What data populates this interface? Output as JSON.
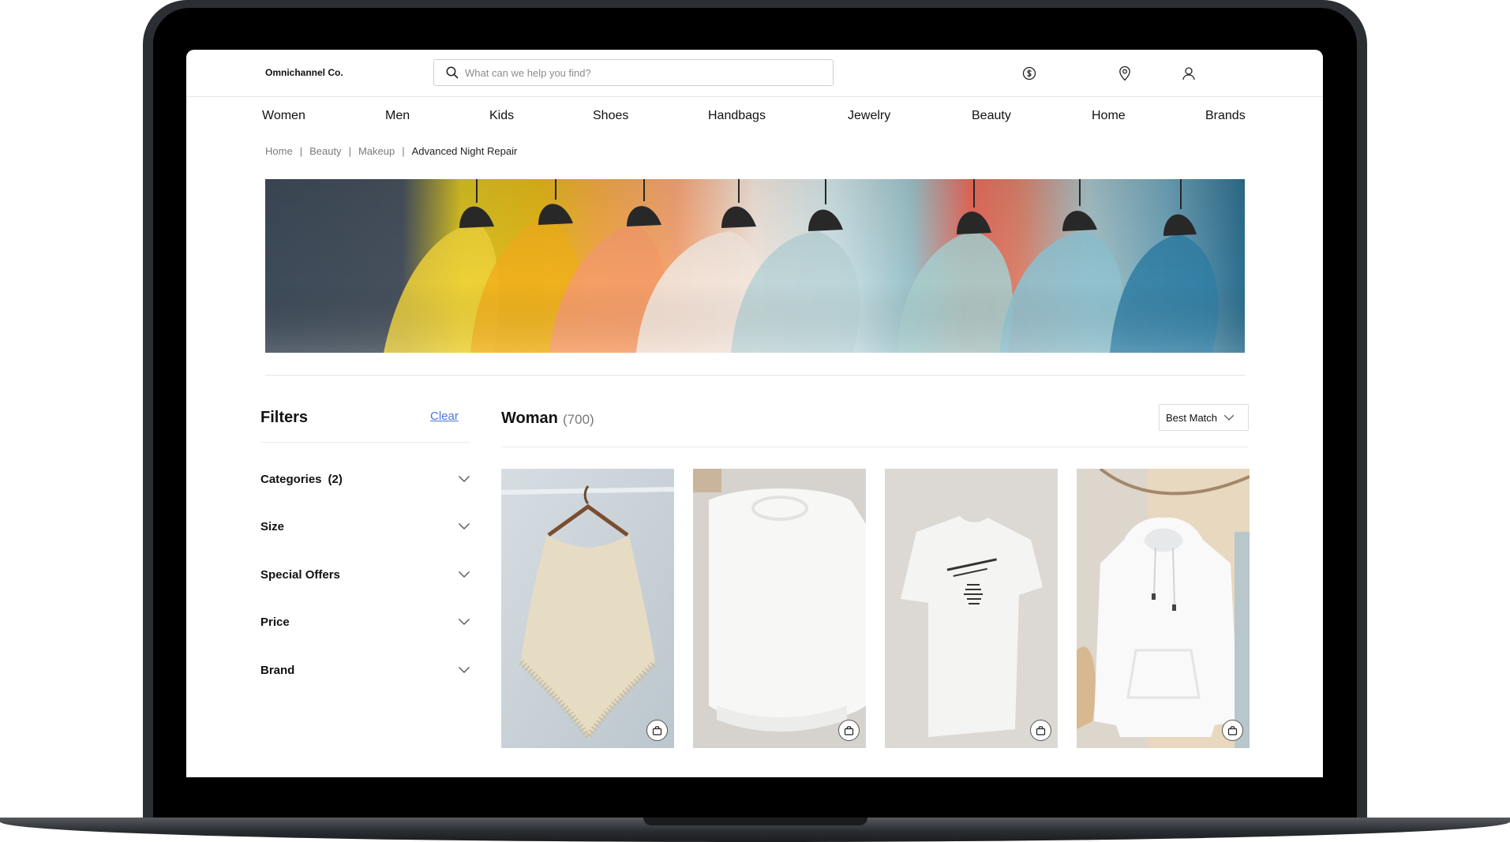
{
  "header": {
    "logo": "Omnichannel Co.",
    "search_placeholder": "What can we help you find?",
    "icons": [
      "dollar-icon",
      "location-pin-icon",
      "user-icon"
    ]
  },
  "nav": [
    "Women",
    "Men",
    "Kids",
    "Shoes",
    "Handbags",
    "Jewelry",
    "Beauty",
    "Home",
    "Brands"
  ],
  "breadcrumb": [
    "Home",
    "Beauty",
    "Makeup",
    "Advanced Night Repair"
  ],
  "breadcrumb_separator": "|",
  "filters": {
    "title": "Filters",
    "clear_label": "Clear",
    "items": [
      {
        "label": "Categories",
        "count": "(2)"
      },
      {
        "label": "Size",
        "count": ""
      },
      {
        "label": "Special Offers",
        "count": ""
      },
      {
        "label": "Price",
        "count": ""
      },
      {
        "label": "Brand",
        "count": ""
      }
    ]
  },
  "results": {
    "title": "Woman",
    "count": "(700)",
    "sort_value": "Best Match"
  },
  "products": [
    {
      "icon": "add-to-bag-icon"
    },
    {
      "icon": "add-to-bag-icon"
    },
    {
      "icon": "add-to-bag-icon"
    },
    {
      "icon": "add-to-bag-icon"
    }
  ],
  "colors": {
    "link": "#4a78d8",
    "text": "#111111",
    "muted": "#7b7b7b"
  }
}
